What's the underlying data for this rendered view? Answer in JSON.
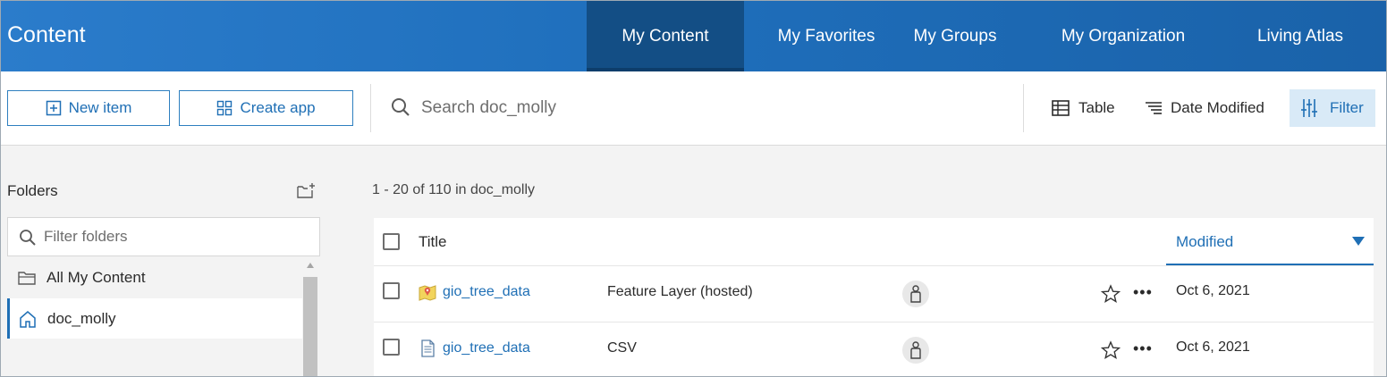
{
  "header": {
    "title": "Content",
    "tabs": [
      {
        "label": "My Content",
        "active": true
      },
      {
        "label": "My Favorites",
        "active": false
      },
      {
        "label": "My Groups",
        "active": false
      },
      {
        "label": "My Organization",
        "active": false
      },
      {
        "label": "Living Atlas",
        "active": false
      }
    ]
  },
  "toolbar": {
    "new_item_label": "New item",
    "create_app_label": "Create app",
    "search_placeholder": "Search doc_molly",
    "table_label": "Table",
    "sort_label": "Date Modified",
    "filter_label": "Filter"
  },
  "sidebar": {
    "title": "Folders",
    "filter_placeholder": "Filter folders",
    "items": [
      {
        "label": "All My Content",
        "icon": "folder-icon",
        "active": false
      },
      {
        "label": "doc_molly",
        "icon": "home-icon",
        "active": true
      }
    ]
  },
  "main": {
    "result_count": "1 - 20 of 110 in doc_molly",
    "columns": {
      "title": "Title",
      "modified": "Modified"
    },
    "rows": [
      {
        "title": "gio_tree_data",
        "type": "Feature Layer (hosted)",
        "modified": "Oct 6, 2021",
        "icon": "feature-layer-icon"
      },
      {
        "title": "gio_tree_data",
        "type": "CSV",
        "modified": "Oct 6, 2021",
        "icon": "csv-file-icon"
      }
    ]
  },
  "colors": {
    "brand_blue": "#1f6fb5",
    "header_active": "#134e85",
    "filter_bg": "#d9eaf7"
  }
}
